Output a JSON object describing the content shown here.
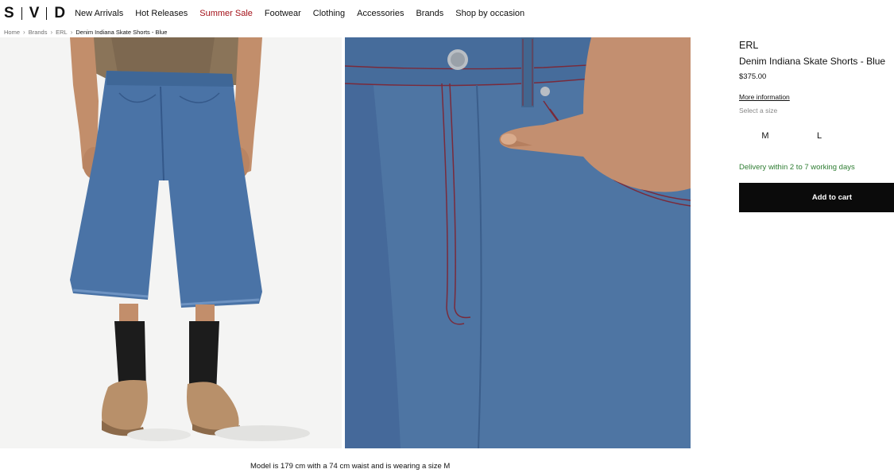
{
  "header": {
    "logo_letters": [
      "S",
      "V",
      "D"
    ],
    "nav": [
      {
        "label": "New Arrivals"
      },
      {
        "label": "Hot Releases"
      },
      {
        "label": "Summer Sale",
        "highlight": "#a4121a"
      },
      {
        "label": "Footwear"
      },
      {
        "label": "Clothing"
      },
      {
        "label": "Accessories"
      },
      {
        "label": "Brands"
      },
      {
        "label": "Shop by occasion"
      }
    ]
  },
  "breadcrumb": {
    "items": [
      "Home",
      "Brands",
      "ERL"
    ],
    "current": "Denim Indiana Skate Shorts - Blue",
    "separator_icon": "chevron-right-icon"
  },
  "gallery": {
    "caption": "Model is 179 cm with a 74 cm waist and is wearing a size M"
  },
  "product": {
    "brand": "ERL",
    "name": "Denim Indiana Skate Shorts - Blue",
    "price": "$375.00",
    "more_info": "More information",
    "select_size": "Select a size",
    "sizes": [
      "M",
      "L"
    ],
    "delivery": "Delivery within 2 to 7 working days",
    "delivery_color": "#2e7d32",
    "add_to_cart": "Add to cart",
    "button_color": "#0b0b0b"
  }
}
